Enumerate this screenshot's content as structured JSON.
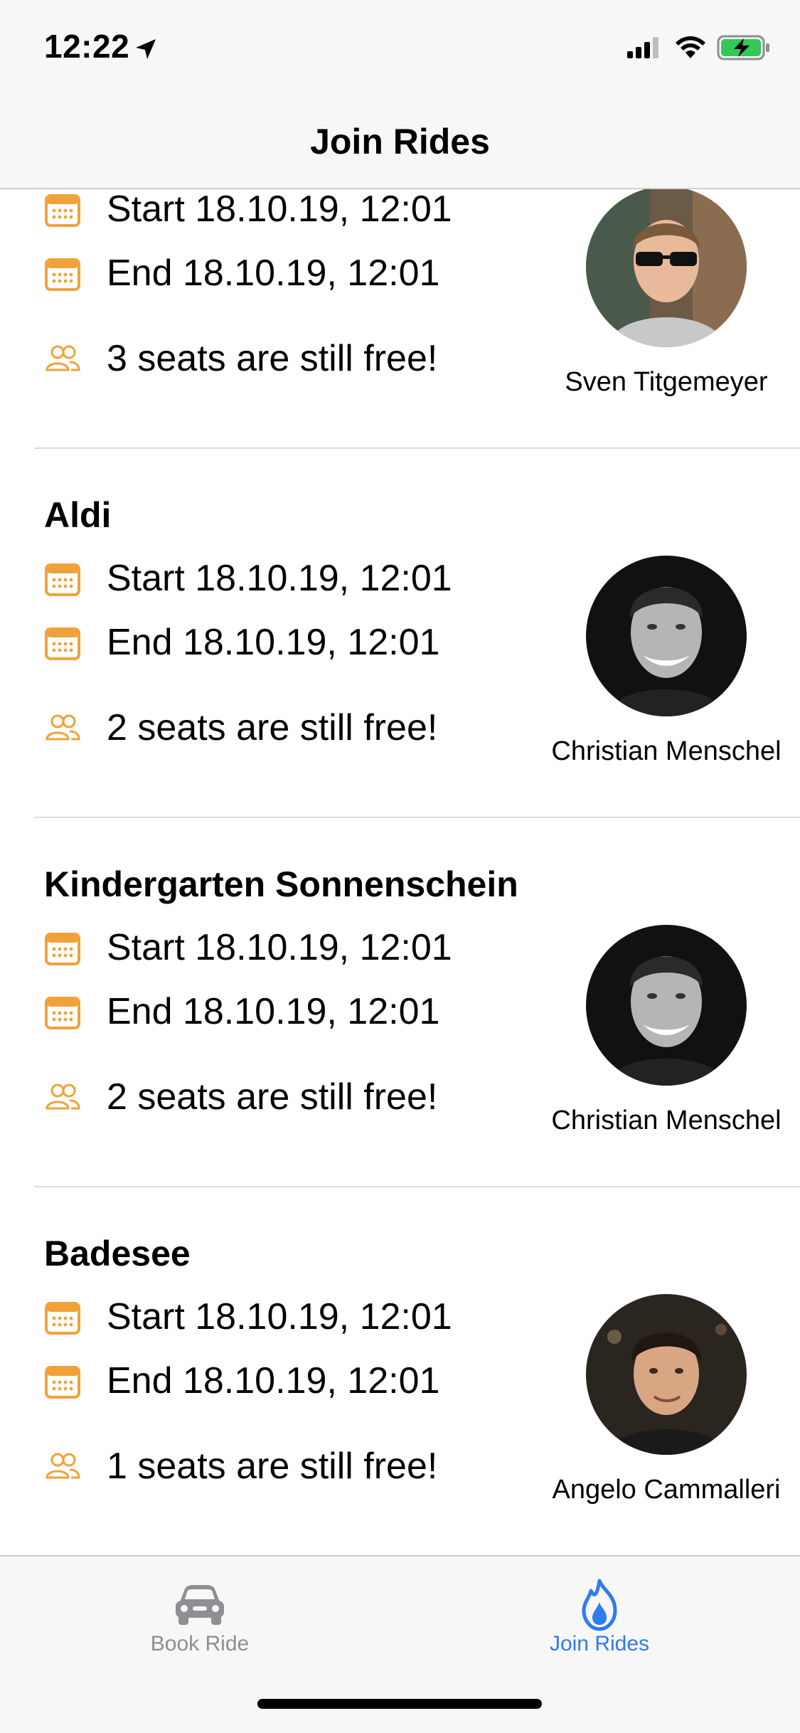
{
  "status_bar": {
    "time": "12:22"
  },
  "nav": {
    "title": "Join Rides"
  },
  "colors": {
    "accent": "#f0a23a",
    "tab_active": "#2f7bf0",
    "tab_inactive": "#8e8e93"
  },
  "rides": [
    {
      "title": "",
      "start": "Start 18.10.19, 12:01",
      "end": "End 18.10.19, 12:01",
      "seats": "3 seats are still free!",
      "driver": "Sven Titgemeyer"
    },
    {
      "title": "Aldi",
      "start": "Start 18.10.19, 12:01",
      "end": "End 18.10.19, 12:01",
      "seats": "2 seats are still free!",
      "driver": "Christian Menschel"
    },
    {
      "title": "Kindergarten Sonnenschein",
      "start": "Start 18.10.19, 12:01",
      "end": "End 18.10.19, 12:01",
      "seats": "2 seats are still free!",
      "driver": "Christian Menschel"
    },
    {
      "title": "Badesee",
      "start": "Start 18.10.19, 12:01",
      "end": "End 18.10.19, 12:01",
      "seats": "1 seats are still free!",
      "driver": "Angelo Cammalleri"
    }
  ],
  "tabs": [
    {
      "label": "Book Ride",
      "icon": "car-icon",
      "active": false
    },
    {
      "label": "Join Rides",
      "icon": "flame-icon",
      "active": true
    }
  ]
}
